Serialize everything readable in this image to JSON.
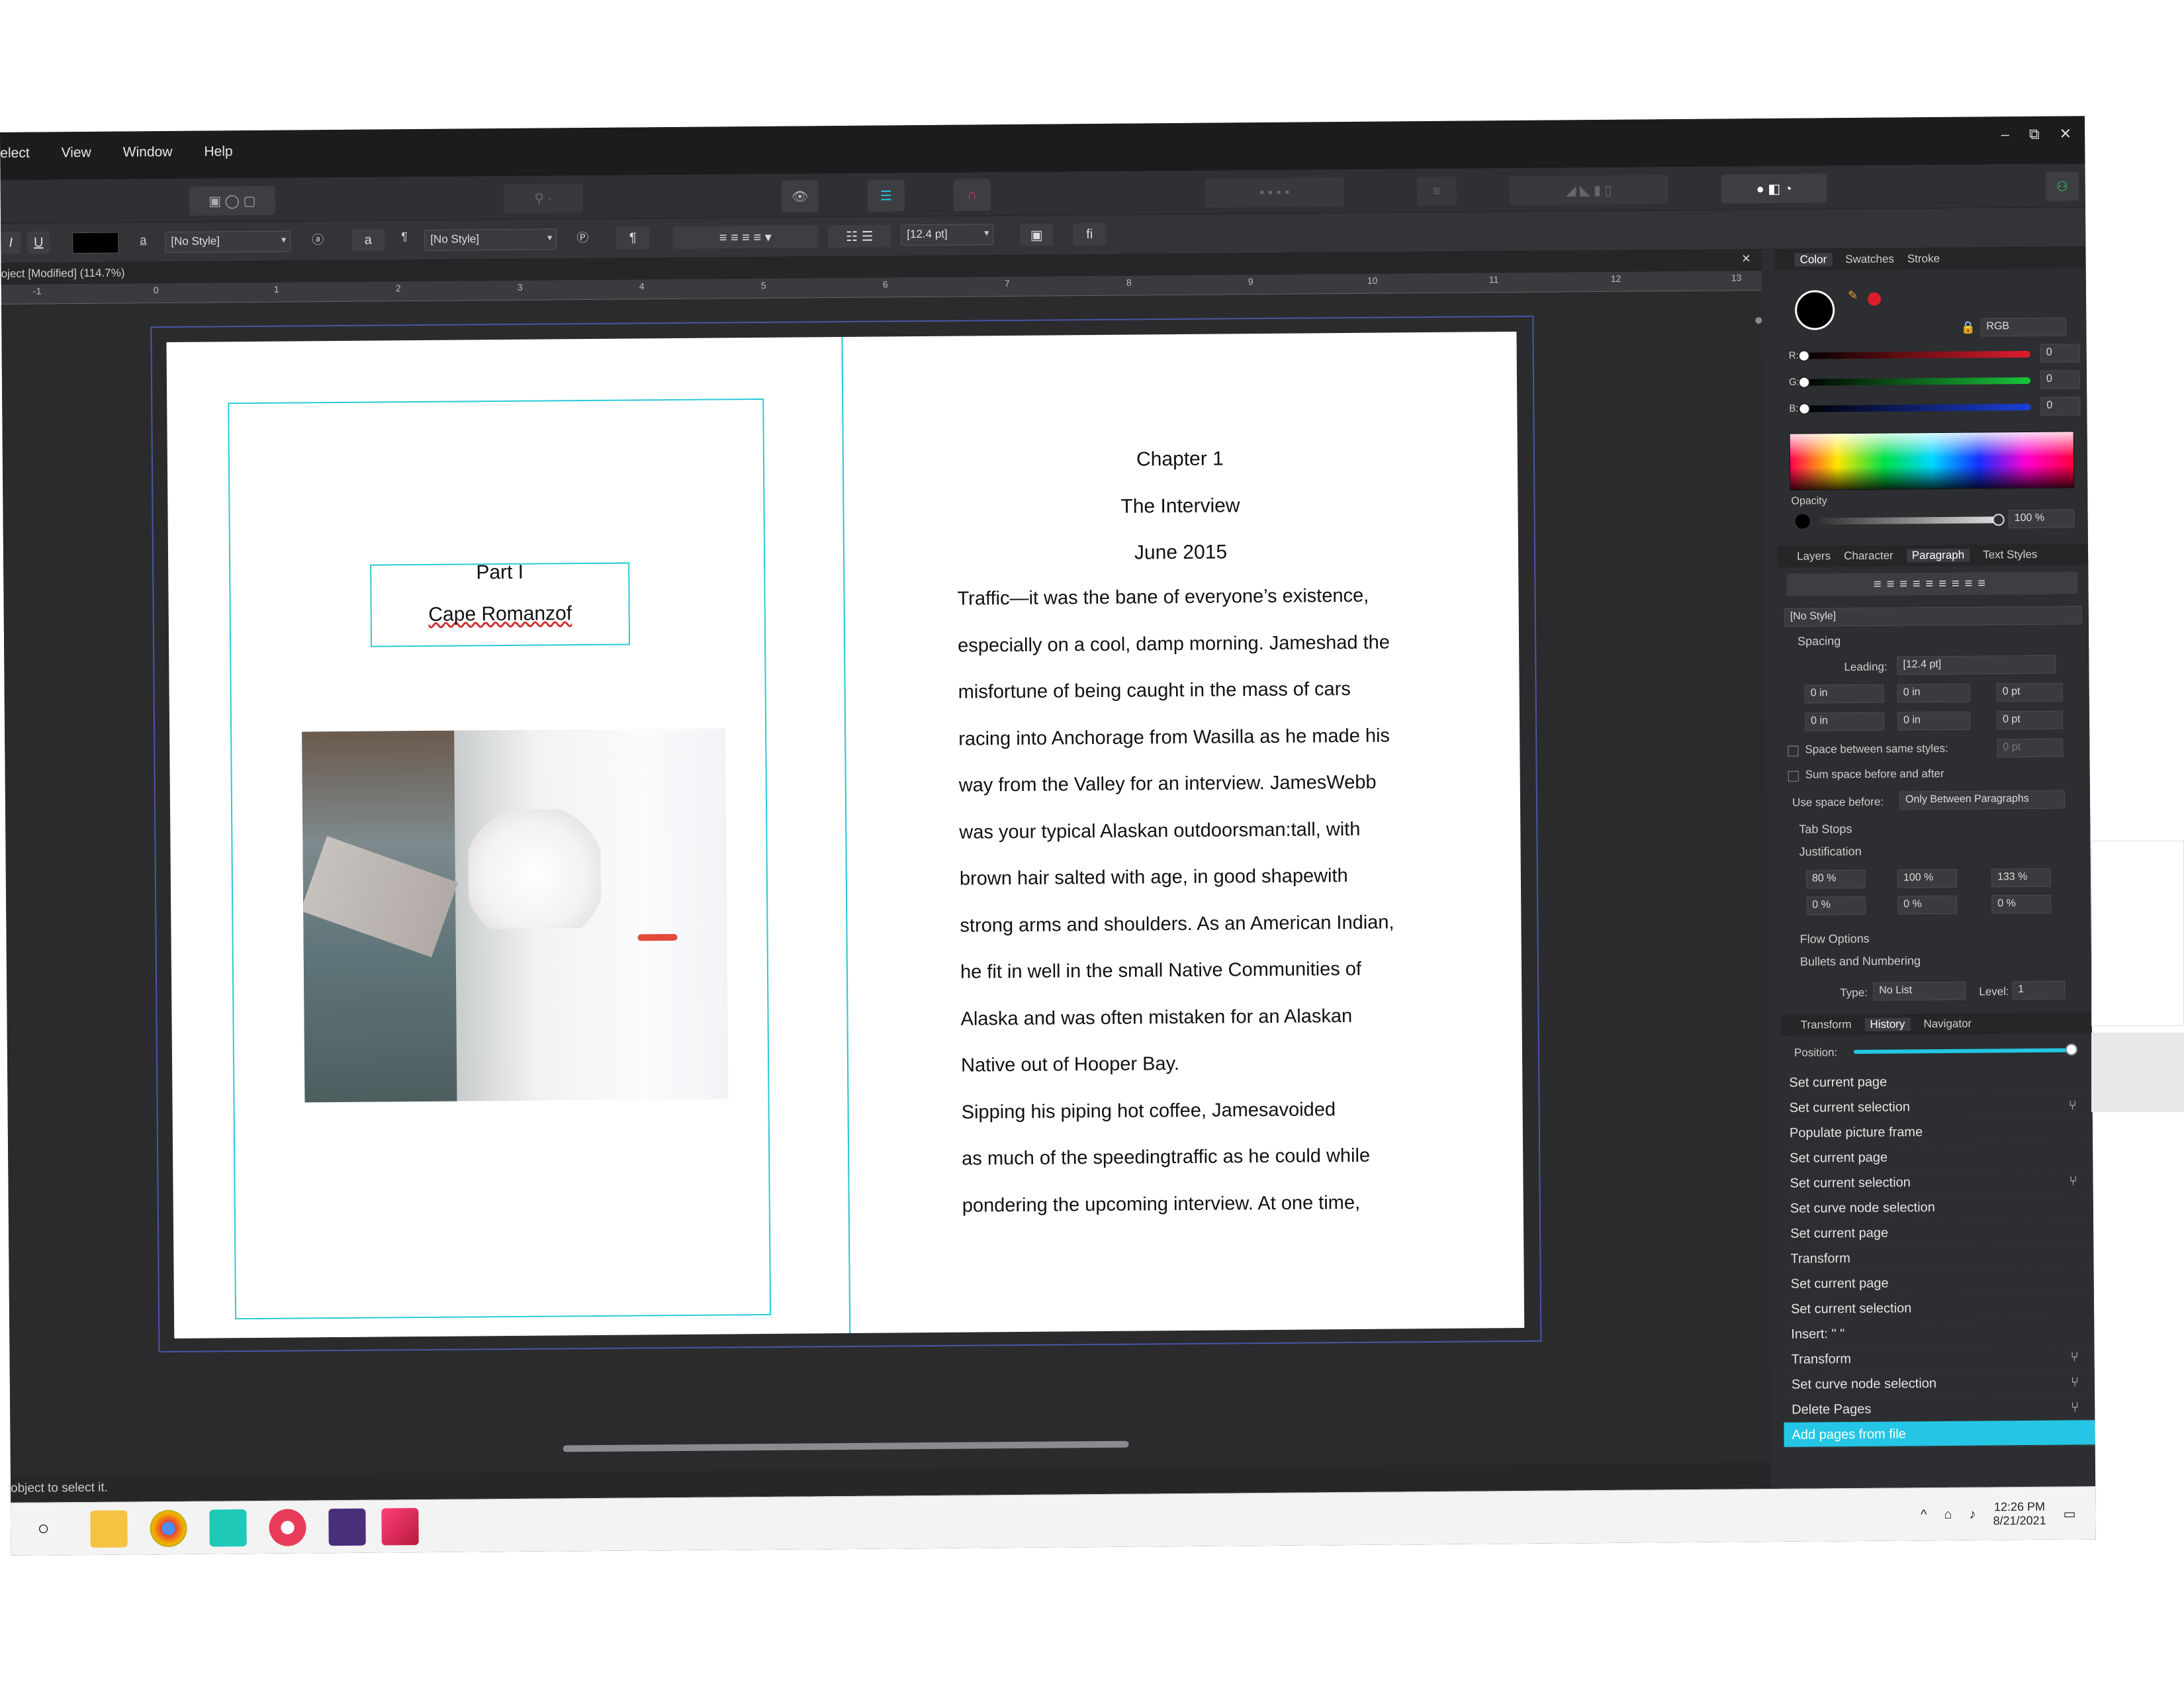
{
  "menu": [
    "elect",
    "View",
    "Window",
    "Help"
  ],
  "window_controls": [
    "–",
    "⧉",
    "✕"
  ],
  "toolbar2": {
    "style1": "[No Style]",
    "style2": "[No Style]",
    "leading": "[12.4 pt]"
  },
  "doc_tab": "oject [Modified] (114.7%)",
  "ruler_ticks": [
    "-1",
    "0",
    "1",
    "2",
    "3",
    "4",
    "5",
    "6",
    "7",
    "8",
    "9",
    "10",
    "11",
    "12",
    "13"
  ],
  "left_page": {
    "part": "Part I",
    "title": "Cape Romanzof"
  },
  "right_page": {
    "chapter": "Chapter 1",
    "subtitle": "The Interview",
    "date": "June 2015",
    "lines": [
      "Traffic—it   was the bane of everyone’s existence,",
      "especially  on a cool,  damp morning.  Jameshad the",
      "misfortune  of  being caught in  the mass of cars",
      "racing into  Anchorage from  Wasilla  as he made his",
      "way from  the Valley  for  an interview.  JamesWebb",
      "was your typical  Alaskan  outdoorsman:tall,  with",
      "brown hair  salted with  age, in  good shapewith",
      "strong arms and shoulders. As  an American  Indian,",
      "he fit  in well  in  the small Native Communities of",
      "Alaska and was often  mistaken for  an Alaskan",
      "Native out of Hooper Bay.",
      "          Sipping his piping  hot coffee,  Jamesavoided",
      "as much of the speedingtraffic   as he could while",
      "pondering the upcoming interview.  At  one time,"
    ]
  },
  "status_text": "object to select it.",
  "color_panel": {
    "tabs": [
      "Color",
      "Swatches",
      "Stroke"
    ],
    "mode": "RGB",
    "r_label": "R:",
    "g_label": "G:",
    "b_label": "B:",
    "r": "0",
    "g": "0",
    "b": "0",
    "opacity_label": "Opacity",
    "opacity": "100 %",
    "colors": {
      "red": "#e01c2c",
      "green": "#19c43c",
      "blue": "#1c3fd8"
    }
  },
  "para_panel": {
    "tabs": [
      "Layers",
      "Character",
      "Paragraph",
      "Text Styles"
    ],
    "style": "[No Style]",
    "spacing_label": "Spacing",
    "leading_label": "Leading:",
    "leading": "[12.4 pt]",
    "fields": [
      "0 in",
      "0 in",
      "0 pt",
      "0 in",
      "0 in",
      "0 pt"
    ],
    "space_between": "Space between same styles:",
    "space_between_val": "0 pt",
    "sum_space": "Sum space before and after",
    "use_space_label": "Use space before:",
    "use_space": "Only Between Paragraphs",
    "tab_stops": "Tab Stops",
    "justification": "Justification",
    "just_vals": [
      "80 %",
      "100 %",
      "133 %",
      "0 %",
      "0 %",
      "0 %"
    ],
    "flow": "Flow Options",
    "bullets": "Bullets and Numbering",
    "type_label": "Type:",
    "type": "No List",
    "level_label": "Level:",
    "level": "1"
  },
  "history_panel": {
    "tabs": [
      "Transform",
      "History",
      "Navigator"
    ],
    "position_label": "Position:",
    "items": [
      "Set current page",
      "Set current selection",
      "Populate picture frame",
      "Set current page",
      "Set current selection",
      "Set curve node selection",
      "Set current page",
      "Transform",
      "Set current page",
      "Set current selection",
      "Insert: \"   \"",
      "Transform",
      "Set curve node selection",
      "Delete Pages",
      "Add pages from file"
    ]
  },
  "clock": {
    "time": "12:26 PM",
    "date": "8/21/2021"
  }
}
